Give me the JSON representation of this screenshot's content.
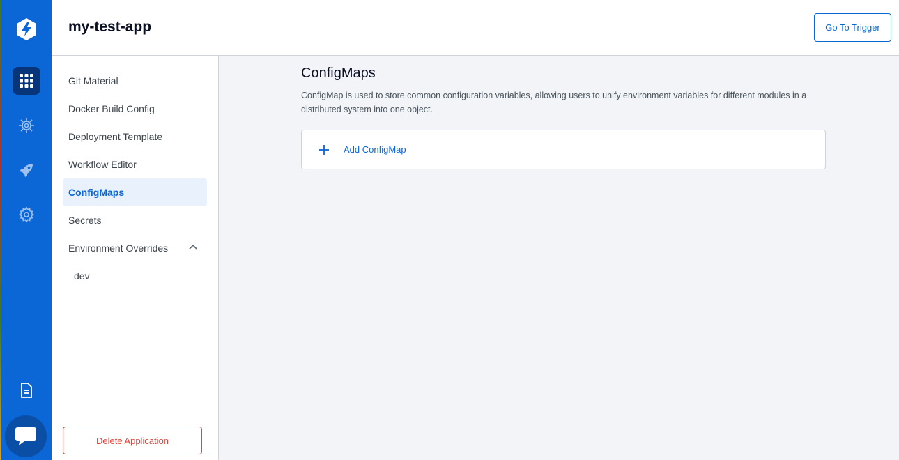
{
  "app": {
    "title": "my-test-app"
  },
  "header": {
    "trigger_label": "Go To Trigger"
  },
  "rail": {
    "items": [
      {
        "icon": "devtron-logo-icon"
      },
      {
        "icon": "grid-apps-icon",
        "active": true
      },
      {
        "icon": "chart-ring-icon"
      },
      {
        "icon": "rocket-icon"
      },
      {
        "icon": "gear-icon"
      },
      {
        "icon": "document-icon"
      },
      {
        "icon": "chat-icon"
      }
    ],
    "color": "#0b66d6",
    "active_color": "#08347a"
  },
  "config_nav": {
    "items": [
      {
        "label": "Git Material"
      },
      {
        "label": "Docker Build Config"
      },
      {
        "label": "Deployment Template"
      },
      {
        "label": "Workflow Editor"
      },
      {
        "label": "ConfigMaps",
        "active": true
      },
      {
        "label": "Secrets"
      },
      {
        "label": "Environment Overrides",
        "expanded": true
      },
      {
        "label": "dev"
      }
    ],
    "delete_label": "Delete Application"
  },
  "main": {
    "title": "ConfigMaps",
    "description": "ConfigMap is used to store common configuration variables, allowing users to unify environment variables for different modules in a distributed system into one object.",
    "add_label": "Add ConfigMap"
  },
  "colors": {
    "accent": "#0b66d6",
    "danger": "#e0453d",
    "background": "#f2f4f7"
  }
}
